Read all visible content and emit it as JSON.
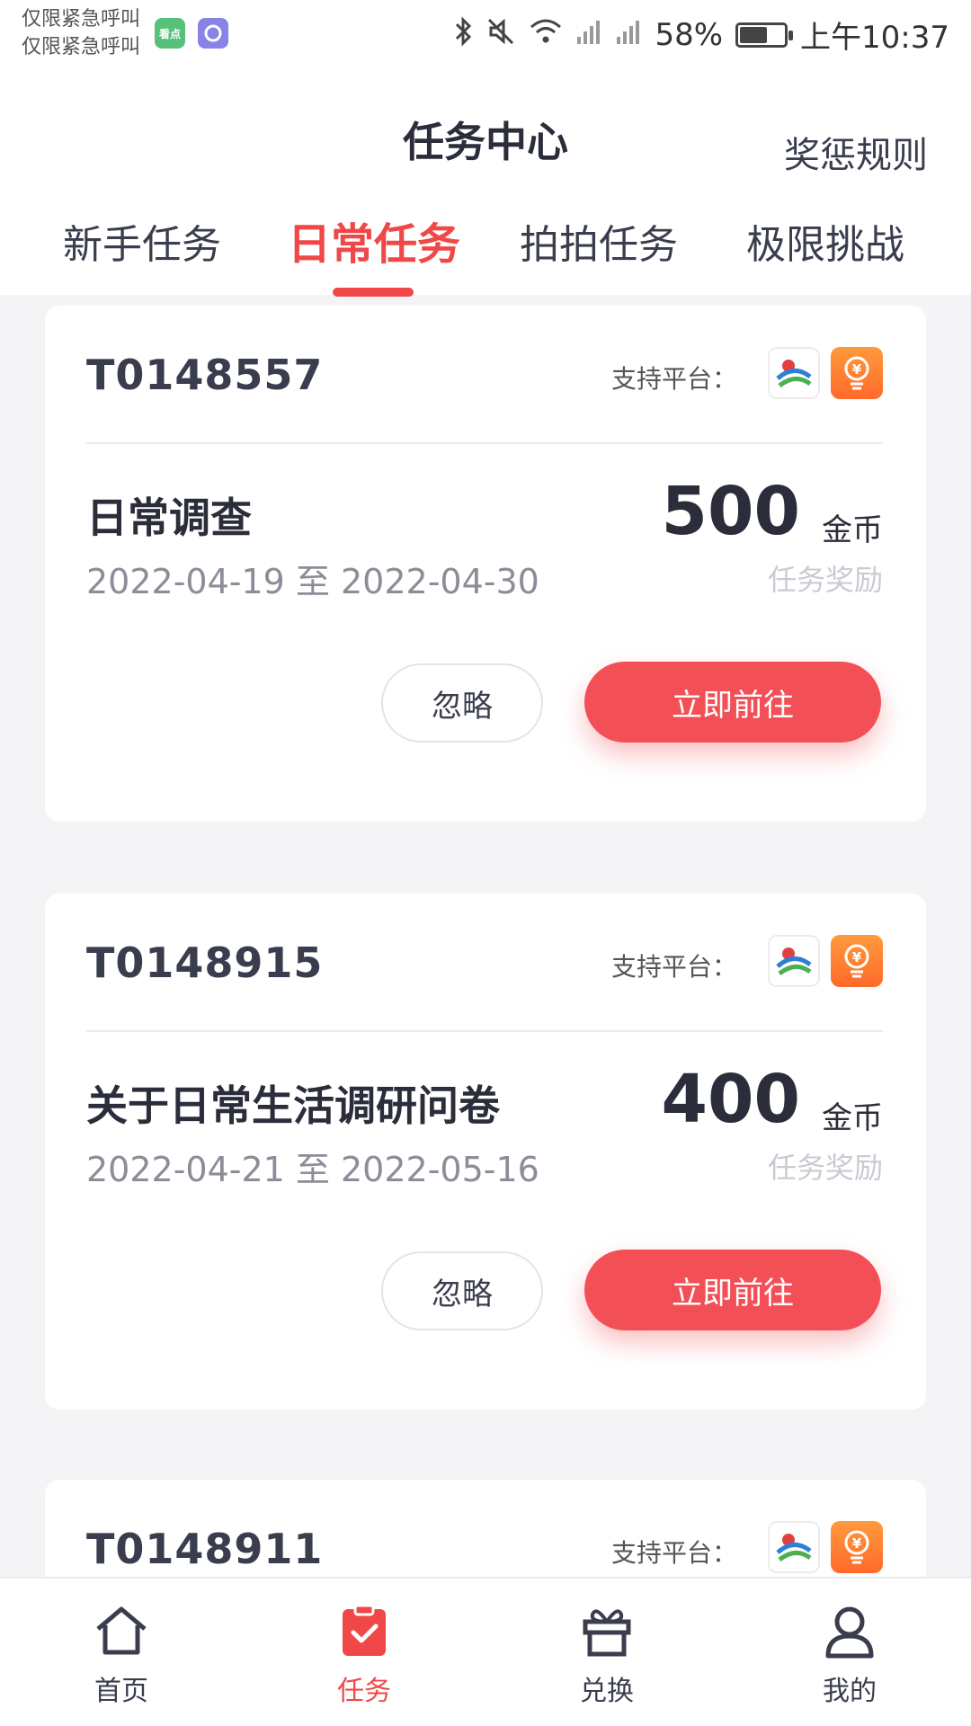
{
  "status_bar": {
    "carrier_line1": "仅限紧急呼叫",
    "carrier_line2": "仅限紧急呼叫",
    "app_badge_green": "看点",
    "battery": "58%",
    "battery_level": 0.58,
    "time": "上午10:37",
    "icons": [
      "bluetooth-icon",
      "mute-icon",
      "wifi-icon",
      "signal-icon",
      "signal-icon",
      "battery-icon"
    ]
  },
  "header": {
    "title": "任务中心",
    "rules_link": "奖惩规则"
  },
  "tabs": [
    {
      "label": "新手任务",
      "active": false
    },
    {
      "label": "日常任务",
      "active": true
    },
    {
      "label": "拍拍任务",
      "active": false
    },
    {
      "label": "极限挑战",
      "active": false
    }
  ],
  "cards": [
    {
      "code": "T0148557",
      "platform_label": "支持平台：",
      "title": "日常调查",
      "date_range": "2022-04-19 至 2022-04-30",
      "reward": "500",
      "reward_unit": "金币",
      "reward_caption": "任务奖励",
      "ignore_label": "忽略",
      "go_label": "立即前往"
    },
    {
      "code": "T0148915",
      "platform_label": "支持平台：",
      "title": "关于日常生活调研问卷",
      "date_range": "2022-04-21 至 2022-05-16",
      "reward": "400",
      "reward_unit": "金币",
      "reward_caption": "任务奖励",
      "ignore_label": "忽略",
      "go_label": "立即前往"
    },
    {
      "code": "T0148911",
      "platform_label": "支持平台："
    }
  ],
  "bottom_nav": [
    {
      "label": "首页",
      "icon": "home-icon",
      "active": false
    },
    {
      "label": "任务",
      "icon": "task-icon",
      "active": true
    },
    {
      "label": "兑换",
      "icon": "gift-icon",
      "active": false
    },
    {
      "label": "我的",
      "icon": "user-icon",
      "active": false
    }
  ],
  "colors": {
    "accent": "#f04848",
    "button": "#f25056",
    "background": "#f4f4f6"
  }
}
